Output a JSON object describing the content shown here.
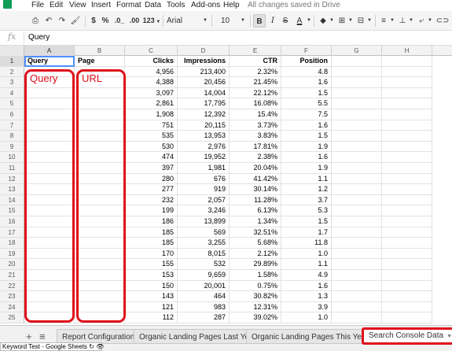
{
  "menu": {
    "items": [
      "File",
      "Edit",
      "View",
      "Insert",
      "Format",
      "Data",
      "Tools",
      "Add-ons",
      "Help"
    ],
    "save_status": "All changes saved in Drive"
  },
  "toolbar": {
    "currency": "$",
    "percent": "%",
    "dec_decrease": ".0_",
    "dec_increase": ".00",
    "number_format": "123",
    "font": "Arial",
    "font_size": "10",
    "bold": "B",
    "italic": "I",
    "strike": "S",
    "text_color": "A"
  },
  "formula_bar": {
    "fx": "fx",
    "value": "Query"
  },
  "columns": [
    "A",
    "B",
    "C",
    "D",
    "E",
    "F",
    "G",
    "H"
  ],
  "selected_column": "A",
  "header_row": {
    "query": "Query",
    "page": "Page",
    "clicks": "Clicks",
    "impressions": "Impressions",
    "ctr": "CTR",
    "position": "Position"
  },
  "rows": [
    {
      "n": "2",
      "clicks": "4,956",
      "impressions": "213,400",
      "ctr": "2.32%",
      "position": "4.8"
    },
    {
      "n": "3",
      "clicks": "4,388",
      "impressions": "20,456",
      "ctr": "21.45%",
      "position": "1.6"
    },
    {
      "n": "4",
      "clicks": "3,097",
      "impressions": "14,004",
      "ctr": "22.12%",
      "position": "1.5"
    },
    {
      "n": "5",
      "clicks": "2,861",
      "impressions": "17,795",
      "ctr": "16.08%",
      "position": "5.5"
    },
    {
      "n": "6",
      "clicks": "1,908",
      "impressions": "12,392",
      "ctr": "15.4%",
      "position": "7.5"
    },
    {
      "n": "7",
      "clicks": "751",
      "impressions": "20,115",
      "ctr": "3.73%",
      "position": "1.6"
    },
    {
      "n": "8",
      "clicks": "535",
      "impressions": "13,953",
      "ctr": "3.83%",
      "position": "1.5"
    },
    {
      "n": "9",
      "clicks": "530",
      "impressions": "2,976",
      "ctr": "17.81%",
      "position": "1.9"
    },
    {
      "n": "10",
      "clicks": "474",
      "impressions": "19,952",
      "ctr": "2.38%",
      "position": "1.6"
    },
    {
      "n": "11",
      "clicks": "397",
      "impressions": "1,981",
      "ctr": "20.04%",
      "position": "1.9"
    },
    {
      "n": "12",
      "clicks": "280",
      "impressions": "676",
      "ctr": "41.42%",
      "position": "1.1"
    },
    {
      "n": "13",
      "clicks": "277",
      "impressions": "919",
      "ctr": "30.14%",
      "position": "1.2"
    },
    {
      "n": "14",
      "clicks": "232",
      "impressions": "2,057",
      "ctr": "11.28%",
      "position": "3.7"
    },
    {
      "n": "15",
      "clicks": "199",
      "impressions": "3,246",
      "ctr": "6.13%",
      "position": "5.3"
    },
    {
      "n": "16",
      "clicks": "186",
      "impressions": "13,899",
      "ctr": "1.34%",
      "position": "1.5"
    },
    {
      "n": "17",
      "clicks": "185",
      "impressions": "569",
      "ctr": "32.51%",
      "position": "1.7"
    },
    {
      "n": "18",
      "clicks": "185",
      "impressions": "3,255",
      "ctr": "5.68%",
      "position": "11.8"
    },
    {
      "n": "19",
      "clicks": "170",
      "impressions": "8,015",
      "ctr": "2.12%",
      "position": "1.0"
    },
    {
      "n": "20",
      "clicks": "155",
      "impressions": "532",
      "ctr": "29.89%",
      "position": "1.1"
    },
    {
      "n": "21",
      "clicks": "153",
      "impressions": "9,659",
      "ctr": "1.58%",
      "position": "4.9"
    },
    {
      "n": "22",
      "clicks": "150",
      "impressions": "20,001",
      "ctr": "0.75%",
      "position": "1.6"
    },
    {
      "n": "23",
      "clicks": "143",
      "impressions": "464",
      "ctr": "30.82%",
      "position": "1.3"
    },
    {
      "n": "24",
      "clicks": "121",
      "impressions": "983",
      "ctr": "12.31%",
      "position": "3.9"
    },
    {
      "n": "25",
      "clicks": "112",
      "impressions": "287",
      "ctr": "39.02%",
      "position": "1.0"
    }
  ],
  "annotations": {
    "query_label": "Query",
    "url_label": "URL"
  },
  "sheet_tabs": [
    {
      "label": "Report Configuration",
      "active": false
    },
    {
      "label": "Organic Landing Pages Last Year",
      "active": false
    },
    {
      "label": "Organic Landing Pages This Year",
      "active": false
    },
    {
      "label": "Search Console Data",
      "active": true
    }
  ],
  "status_bar": "Keyword Test - Google Sheets",
  "colors": {
    "annotation": "#e0101a",
    "selection": "#4d90fe",
    "brand": "#0f9d58"
  }
}
